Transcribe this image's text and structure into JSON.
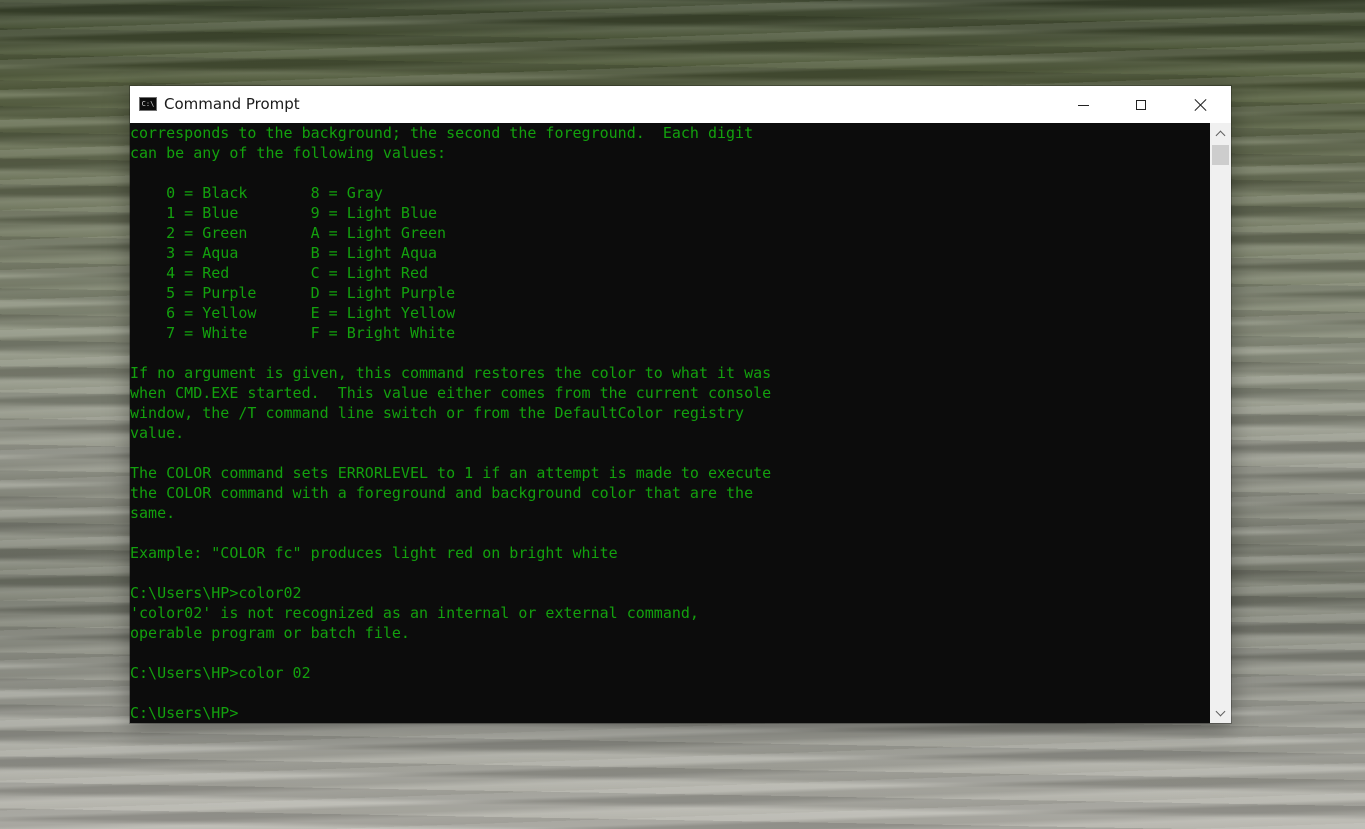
{
  "window": {
    "title": "Command Prompt",
    "icon": "cmd-app-icon",
    "icon_text": "C:\\",
    "controls": {
      "minimize": "minimize-icon",
      "maximize": "maximize-icon",
      "close": "close-icon"
    }
  },
  "console": {
    "foreground_color": "#13a10e",
    "background_color": "#0c0c0c",
    "lines": [
      "corresponds to the background; the second the foreground.  Each digit",
      "can be any of the following values:",
      "",
      "    0 = Black       8 = Gray",
      "    1 = Blue        9 = Light Blue",
      "    2 = Green       A = Light Green",
      "    3 = Aqua        B = Light Aqua",
      "    4 = Red         C = Light Red",
      "    5 = Purple      D = Light Purple",
      "    6 = Yellow      E = Light Yellow",
      "    7 = White       F = Bright White",
      "",
      "If no argument is given, this command restores the color to what it was",
      "when CMD.EXE started.  This value either comes from the current console",
      "window, the /T command line switch or from the DefaultColor registry",
      "value.",
      "",
      "The COLOR command sets ERRORLEVEL to 1 if an attempt is made to execute",
      "the COLOR command with a foreground and background color that are the",
      "same.",
      "",
      "Example: \"COLOR fc\" produces light red on bright white",
      "",
      "C:\\Users\\HP>color02",
      "'color02' is not recognized as an internal or external command,",
      "operable program or batch file.",
      "",
      "C:\\Users\\HP>color 02",
      "",
      "C:\\Users\\HP>"
    ]
  },
  "scrollbar": {
    "up_icon": "chevron-up-icon",
    "down_icon": "chevron-down-icon"
  }
}
